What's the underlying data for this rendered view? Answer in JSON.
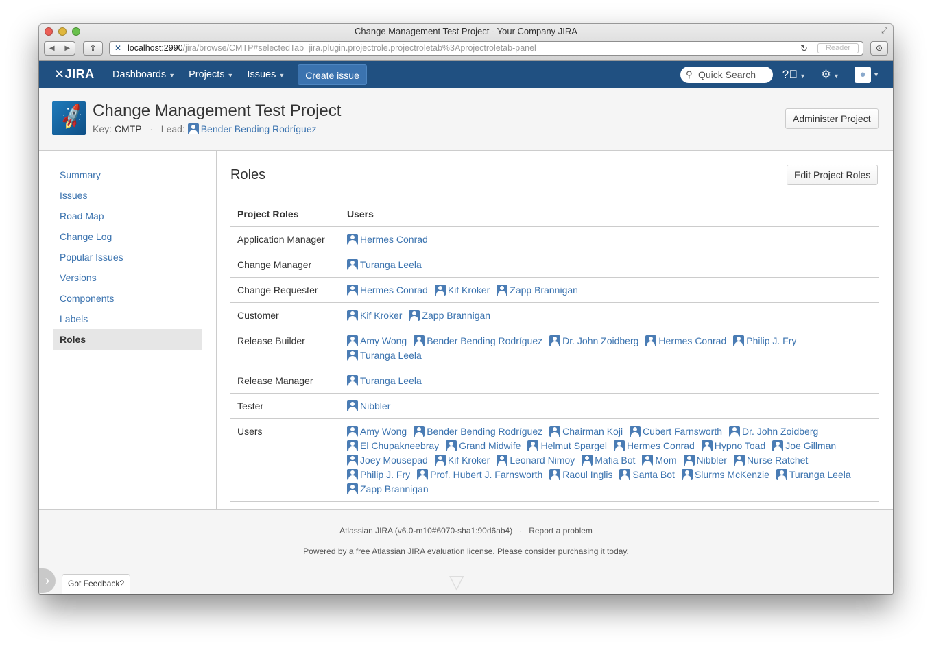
{
  "browser": {
    "window_title": "Change Management Test Project - Your Company JIRA",
    "url_host": "localhost:2990",
    "url_path": "/jira/browse/CMTP#selectedTab=jira.plugin.projectrole.projectroletab%3Aprojectroletab-panel",
    "reader_label": "Reader"
  },
  "header": {
    "logo": "JIRA",
    "nav": [
      "Dashboards",
      "Projects",
      "Issues"
    ],
    "create_label": "Create issue",
    "search_placeholder": "Quick Search"
  },
  "project": {
    "title": "Change Management Test Project",
    "key_label": "Key:",
    "key": "CMTP",
    "lead_label": "Lead:",
    "lead": "Bender Bending Rodríguez",
    "administer_label": "Administer Project"
  },
  "sidebar": {
    "items": [
      {
        "label": "Summary"
      },
      {
        "label": "Issues"
      },
      {
        "label": "Road Map"
      },
      {
        "label": "Change Log"
      },
      {
        "label": "Popular Issues"
      },
      {
        "label": "Versions"
      },
      {
        "label": "Components"
      },
      {
        "label": "Labels"
      },
      {
        "label": "Roles"
      }
    ],
    "active": "Roles"
  },
  "main": {
    "heading": "Roles",
    "edit_label": "Edit Project Roles",
    "columns": [
      "Project Roles",
      "Users"
    ],
    "rows": [
      {
        "role": "Application Manager",
        "users": [
          "Hermes Conrad"
        ]
      },
      {
        "role": "Change Manager",
        "users": [
          "Turanga Leela"
        ]
      },
      {
        "role": "Change Requester",
        "users": [
          "Hermes Conrad",
          "Kif Kroker",
          "Zapp Brannigan"
        ]
      },
      {
        "role": "Customer",
        "users": [
          "Kif Kroker",
          "Zapp Brannigan"
        ]
      },
      {
        "role": "Release Builder",
        "users": [
          "Amy Wong",
          "Bender Bending Rodríguez",
          "Dr. John Zoidberg",
          "Hermes Conrad",
          "Philip J. Fry",
          "Turanga Leela"
        ]
      },
      {
        "role": "Release Manager",
        "users": [
          "Turanga Leela"
        ]
      },
      {
        "role": "Tester",
        "users": [
          "Nibbler"
        ]
      },
      {
        "role": "Users",
        "users": [
          "Amy Wong",
          "Bender Bending Rodríguez",
          "Chairman Koji",
          "Cubert Farnsworth",
          "Dr. John Zoidberg",
          "El Chupakneebray",
          "Grand Midwife",
          "Helmut Spargel",
          "Hermes Conrad",
          "Hypno Toad",
          "Joe Gillman",
          "Joey Mousepad",
          "Kif Kroker",
          "Leonard Nimoy",
          "Mafia Bot",
          "Mom",
          "Nibbler",
          "Nurse Ratchet",
          "Philip J. Fry",
          "Prof. Hubert J. Farnsworth",
          "Raoul Inglis",
          "Santa Bot",
          "Slurms McKenzie",
          "Turanga Leela",
          "Zapp Brannigan"
        ]
      }
    ]
  },
  "footer": {
    "version": "Atlassian JIRA (v6.0-m10#6070-sha1:90d6ab4)",
    "report": "Report a problem",
    "license": "Powered by a free Atlassian JIRA evaluation license. Please consider purchasing it today.",
    "feedback": "Got Feedback?"
  },
  "colors": {
    "header_bg": "#205081",
    "link": "#3b73af",
    "create_btn": "#3b73af"
  }
}
